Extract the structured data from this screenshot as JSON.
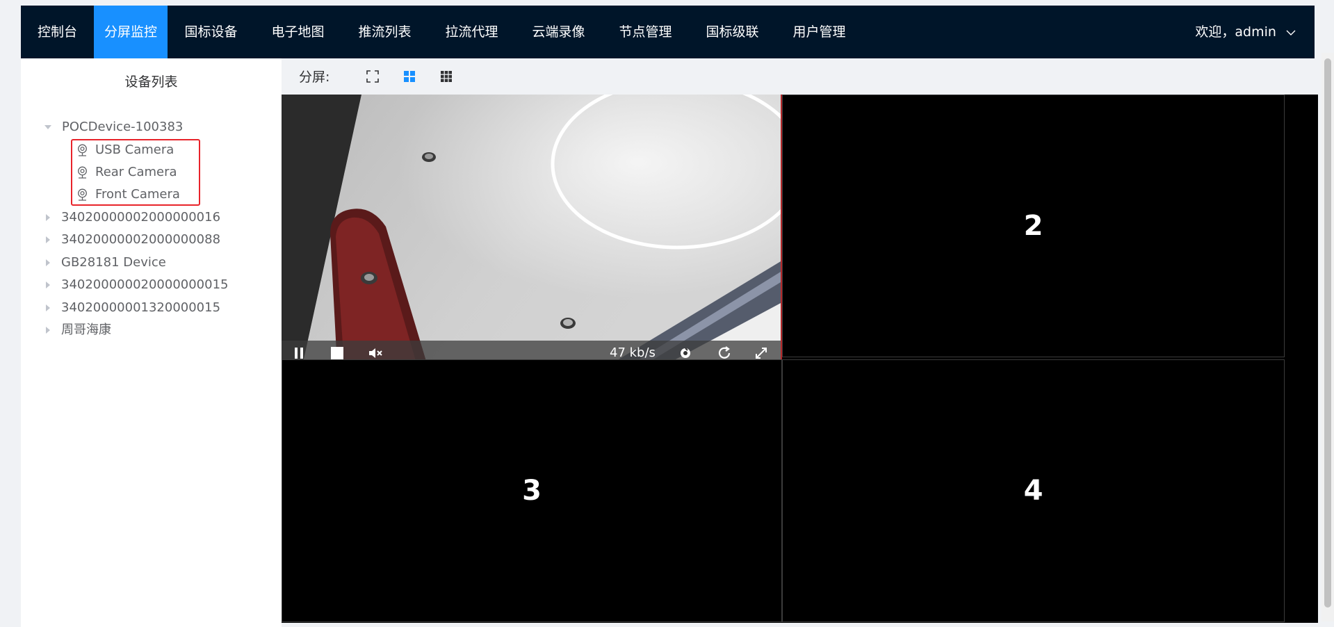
{
  "nav": {
    "items": [
      "控制台",
      "分屏监控",
      "国标设备",
      "电子地图",
      "推流列表",
      "拉流代理",
      "云端录像",
      "节点管理",
      "国标级联",
      "用户管理"
    ],
    "active": "分屏监控",
    "welcome": "欢迎，admin"
  },
  "sidebar": {
    "title": "设备列表",
    "tree": [
      {
        "label": "POCDevice-100383",
        "expanded": true,
        "children": [
          "USB Camera",
          "Rear Camera",
          "Front Camera"
        ]
      },
      {
        "label": "34020000002000000016",
        "expanded": false
      },
      {
        "label": "34020000002000000088",
        "expanded": false
      },
      {
        "label": "GB28181 Device",
        "expanded": false
      },
      {
        "label": "340200000020000000015",
        "expanded": false
      },
      {
        "label": "34020000001320000015",
        "expanded": false
      },
      {
        "label": "周哥海康",
        "expanded": false
      }
    ]
  },
  "split": {
    "label": "分屏:",
    "modes": [
      "single-screen",
      "four-screen",
      "nine-screen"
    ],
    "active_mode": "four-screen",
    "accent": "#1890ff"
  },
  "player": {
    "bitrate": "47 kb/s",
    "cells": [
      "2",
      "3",
      "4"
    ]
  },
  "colors": {
    "nav_bg": "#001529",
    "active_tab": "#1890ff",
    "highlight": "#e8232a"
  }
}
